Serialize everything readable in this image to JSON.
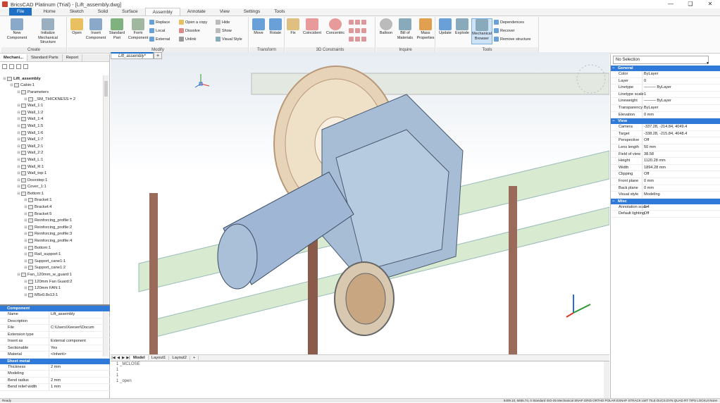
{
  "window": {
    "title": "BricsCAD Platinum (Trial) - [Lift_assembly.dwg]",
    "controls": [
      "—",
      "❑",
      "✕"
    ]
  },
  "tabs": [
    "File",
    "Home",
    "Sketch",
    "Solid",
    "Surface",
    "Assembly",
    "Annotate",
    "View",
    "Settings",
    "Tools"
  ],
  "active_tab": "Assembly",
  "ribbon": {
    "create": {
      "title": "Create",
      "new": "New Component",
      "init": "Initialize Mechanical Structure"
    },
    "modify": {
      "title": "Modify",
      "open": "Open",
      "insert": "Insert Component",
      "standard": "Standard Part",
      "form": "Form Component",
      "replace": "Replace",
      "local": "Local",
      "external": "External",
      "open_copy": "Open a copy",
      "dissolve": "Dissolve",
      "unlink": "Unlink",
      "hide": "Hide",
      "show": "Show",
      "visual_style": "Visual Style"
    },
    "transform": {
      "title": "Transform",
      "move": "Move",
      "rotate": "Rotate"
    },
    "constraints": {
      "title": "3D Constraints",
      "fix": "Fix",
      "coincident": "Coincident",
      "concentric": "Concentric"
    },
    "inquire": {
      "title": "Inquire",
      "balloon": "Balloon",
      "bom": "Bill of Materials",
      "mass": "Mass Properties"
    },
    "tools": {
      "title": "Tools",
      "update": "Update",
      "explode": "Explode",
      "browser": "Mechanical Browser",
      "dependences": "Dependences",
      "recover": "Recover",
      "remove": "Remove structure"
    }
  },
  "left_panel": {
    "tabs": [
      "Mechani...",
      "Standard Parts",
      "Report"
    ],
    "tree": [
      {
        "d": 0,
        "t": "Lift_assembly",
        "bold": true
      },
      {
        "d": 1,
        "t": "Cabin:1"
      },
      {
        "d": 2,
        "t": "Parameters"
      },
      {
        "d": 3,
        "t": "_SM_THICKNESS = 2"
      },
      {
        "d": 2,
        "t": "Wall_1:1"
      },
      {
        "d": 2,
        "t": "Wall_1:2"
      },
      {
        "d": 2,
        "t": "Wall_1:4"
      },
      {
        "d": 2,
        "t": "Wall_1:5"
      },
      {
        "d": 2,
        "t": "Wall_1:6"
      },
      {
        "d": 2,
        "t": "Wall_1:7"
      },
      {
        "d": 2,
        "t": "Wall_2:1"
      },
      {
        "d": 2,
        "t": "Wall_2:2"
      },
      {
        "d": 2,
        "t": "Wall_L:1"
      },
      {
        "d": 2,
        "t": "Wall_R:1"
      },
      {
        "d": 2,
        "t": "Wall_top:1"
      },
      {
        "d": 2,
        "t": "Doorstep:1"
      },
      {
        "d": 2,
        "t": "Cover_1:1"
      },
      {
        "d": 2,
        "t": "Bottom:1"
      },
      {
        "d": 3,
        "t": "Bracket:1"
      },
      {
        "d": 3,
        "t": "Bracket:4"
      },
      {
        "d": 3,
        "t": "Bracket:5"
      },
      {
        "d": 3,
        "t": "Reinforcing_profile:1"
      },
      {
        "d": 3,
        "t": "Reinforcing_profile:2"
      },
      {
        "d": 3,
        "t": "Reinforcing_profile:3"
      },
      {
        "d": 3,
        "t": "Reinforcing_profile:4"
      },
      {
        "d": 3,
        "t": "Bottom:1"
      },
      {
        "d": 3,
        "t": "Rail_support:1"
      },
      {
        "d": 3,
        "t": "Support_cane1:1"
      },
      {
        "d": 3,
        "t": "Support_cane1:2"
      },
      {
        "d": 2,
        "t": "Fan_120mm_w_guard:1"
      },
      {
        "d": 3,
        "t": "120mm Fan Guard:2"
      },
      {
        "d": 3,
        "t": "120mm FAN:1"
      },
      {
        "d": 3,
        "t": "M5x0.8x13:1"
      }
    ],
    "component_header": "Component",
    "component": [
      [
        "Name",
        "Lift_assembly"
      ],
      [
        "Description",
        ""
      ],
      [
        "File",
        "C:\\Users\\Xeeveri\\Docum"
      ],
      [
        "Extension type",
        ""
      ],
      [
        "Insert as",
        "External component"
      ],
      [
        "Sectionable",
        "Yes"
      ],
      [
        "Material",
        "<Inherit>"
      ]
    ],
    "sheet_header": "Sheet metal",
    "sheet": [
      [
        "Thickness",
        "2 mm"
      ],
      [
        "Modeling",
        ""
      ],
      [
        "Bend radius",
        "2 mm"
      ],
      [
        "Bend relief width",
        "1 mm"
      ]
    ]
  },
  "viewport": {
    "doc_tab": "Lift_assembly*",
    "layouts": [
      "Model",
      "Layout1",
      "Layout2"
    ]
  },
  "command": {
    "lines": [
      "1  _MCLOSE",
      "1",
      "1",
      "1  _open"
    ]
  },
  "right_panel": {
    "selection": "No Selection",
    "sections": [
      {
        "h": "General",
        "rows": [
          [
            "Color",
            "ByLayer"
          ],
          [
            "Layer",
            "0"
          ],
          [
            "Linetype",
            "——— ByLayer"
          ],
          [
            "Linetype scale",
            "1"
          ],
          [
            "Lineweight",
            "——— ByLayer"
          ],
          [
            "Transparency",
            "ByLayer"
          ],
          [
            "Elevation",
            "0 mm"
          ]
        ]
      },
      {
        "h": "View",
        "rows": [
          [
            "Camera",
            "-337.28, -214.84, 4049.4"
          ],
          [
            "Target",
            "-338.28, -215.84, 4048.4"
          ],
          [
            "Perspective",
            "Off"
          ],
          [
            "Lens length",
            "50 mm"
          ],
          [
            "Field of view",
            "38.58"
          ],
          [
            "Height",
            "1120.28 mm"
          ],
          [
            "Width",
            "1894.28 mm"
          ],
          [
            "Clipping",
            "Off"
          ],
          [
            "Front plane",
            "0 mm"
          ],
          [
            "Back plane",
            "0 mm"
          ],
          [
            "Visual style",
            "Modeling"
          ]
        ]
      },
      {
        "h": "Misc",
        "rows": [
          [
            "Annotation scale",
            "1:4"
          ],
          [
            "Default lighting",
            "Off"
          ]
        ]
      }
    ]
  },
  "status": {
    "left": "Ready",
    "right": "5409.10, 6655.74, 0   Standard  ISO-25  Mechanical  SNAP  GRID  ORTHO  POLAR  ESNAP  STRACK  LWT  TILE  DUCS  DYN  QUAD  RT  TIPS  LOCKUI  None"
  }
}
